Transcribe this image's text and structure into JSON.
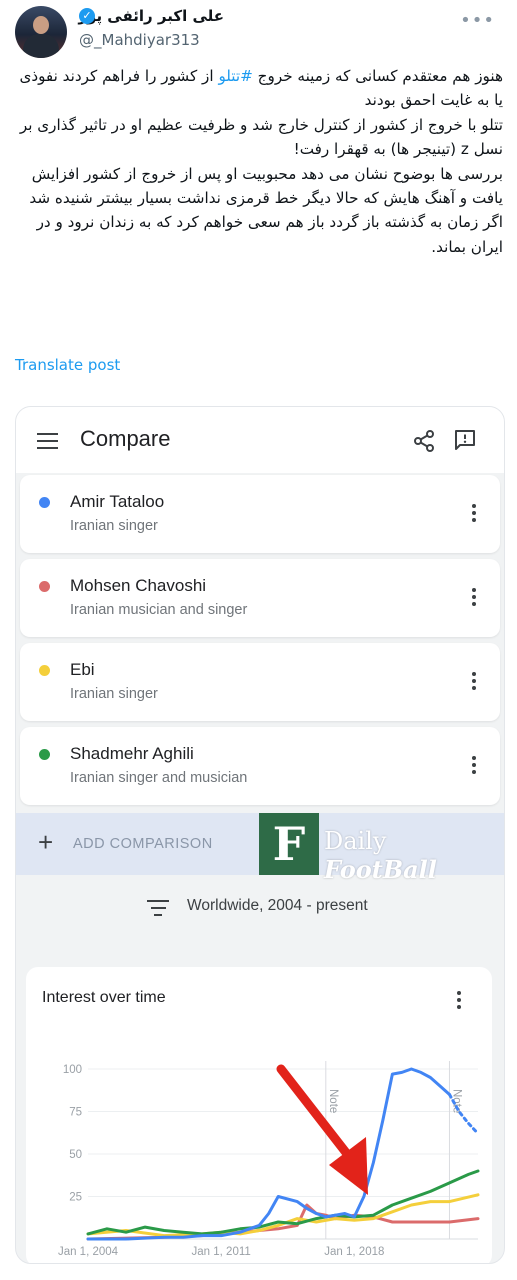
{
  "tweet": {
    "display_name": "علی اکبر رائفی پور",
    "handle": "@_Mahdiyar313",
    "text_line1_before": "هنوز هم معتقدم کسانی که زمینه خروج ",
    "hashtag": "#تتلو",
    "text_line1_after": " از کشور را فراهم کردند نفوذی یا به غایت احمق بودند",
    "paragraph2": "تتلو با خروج از کشور از کنترل خارج شد و ظرفیت عظیم او در تاثیر گذاری بر نسل z (تینیجر ها) به قهقرا رفت!",
    "paragraph3": "بررسی ها بوضوح نشان می دهد محبوبیت او پس از خروج از کشور افزایش یافت و آهنگ هایش که حالا دیگر خط قرمزی نداشت بسیار بیشتر شنیده شد",
    "paragraph4": "اگر زمان به گذشته باز گردد باز هم سعی خواهم کرد که به زندان نرود و در ایران بماند.",
    "translate_label": "Translate post"
  },
  "trends": {
    "page_title": "Compare",
    "terms": [
      {
        "name": "Amir Tataloo",
        "subtitle": "Iranian singer",
        "color": "#4285f4"
      },
      {
        "name": "Mohsen Chavoshi",
        "subtitle": "Iranian musician and singer",
        "color": "#db6b6b"
      },
      {
        "name": "Ebi",
        "subtitle": "Iranian singer",
        "color": "#f4cf3b"
      },
      {
        "name": "Shadmehr Aghili",
        "subtitle": "Iranian singer and musician",
        "color": "#2a9a48"
      }
    ],
    "add_comparison_label": "ADD COMPARISON",
    "filter_label": "Worldwide, 2004 - present",
    "chart_title": "Interest over time",
    "watermark_logo": "F",
    "watermark_plain": "Daily ",
    "watermark_styled": "FootBall"
  },
  "chart_data": {
    "type": "line",
    "title": "Interest over time",
    "x_tick_labels": [
      "Jan 1, 2004",
      "Jan 1, 2011",
      "Jan 1, 2018"
    ],
    "y_tick_labels": [
      "100",
      "75",
      "50",
      "25"
    ],
    "ylim": [
      0,
      100
    ],
    "xlim": [
      2004,
      2024.5
    ],
    "grid": true,
    "note_label": "Note",
    "note_x": [
      2016.5,
      2023.0
    ],
    "annotation": "red arrow pointing to the lines near 2017",
    "series": [
      {
        "name": "Amir Tataloo",
        "color": "#4285f4",
        "x": [
          2004,
          2006,
          2008,
          2009,
          2010,
          2011,
          2012,
          2013,
          2013.5,
          2014,
          2015,
          2015.5,
          2016,
          2016.5,
          2017,
          2017.5,
          2018,
          2018.5,
          2019,
          2019.5,
          2020,
          2020.5,
          2021,
          2021.5,
          2022,
          2022.5,
          2023
        ],
        "y": [
          0,
          0,
          1,
          1,
          2,
          2,
          4,
          8,
          15,
          25,
          22,
          18,
          15,
          13,
          14,
          15,
          13,
          25,
          45,
          70,
          97,
          98,
          100,
          98,
          95,
          90,
          85
        ],
        "projection": {
          "x": [
            2023,
            2023.5,
            2024,
            2024.5
          ],
          "y": [
            85,
            75,
            68,
            62
          ]
        }
      },
      {
        "name": "Mohsen Chavoshi",
        "color": "#db6b6b",
        "x": [
          2004,
          2008,
          2010,
          2012,
          2014,
          2015,
          2015.5,
          2016,
          2016.5,
          2017,
          2018,
          2019,
          2020,
          2022,
          2023,
          2024.5
        ],
        "y": [
          0,
          1,
          2,
          4,
          6,
          8,
          20,
          15,
          14,
          12,
          14,
          13,
          10,
          10,
          10,
          12
        ]
      },
      {
        "name": "Ebi",
        "color": "#f4cf3b",
        "x": [
          2004,
          2006,
          2008,
          2010,
          2011,
          2012,
          2013,
          2014,
          2015,
          2016,
          2017,
          2018,
          2019,
          2020,
          2021,
          2022,
          2023,
          2024.5
        ],
        "y": [
          3,
          5,
          2,
          3,
          4,
          3,
          5,
          8,
          12,
          10,
          12,
          11,
          12,
          16,
          20,
          22,
          22,
          26
        ]
      },
      {
        "name": "Shadmehr Aghili",
        "color": "#2a9a48",
        "x": [
          2004,
          2005,
          2006,
          2007,
          2008,
          2009,
          2010,
          2011,
          2012,
          2013,
          2014,
          2015,
          2016,
          2017,
          2018,
          2019,
          2020,
          2021,
          2022,
          2023,
          2024,
          2024.5
        ],
        "y": [
          3,
          6,
          4,
          7,
          5,
          4,
          3,
          4,
          6,
          7,
          10,
          9,
          12,
          14,
          13,
          14,
          20,
          24,
          28,
          33,
          38,
          40
        ]
      }
    ]
  }
}
